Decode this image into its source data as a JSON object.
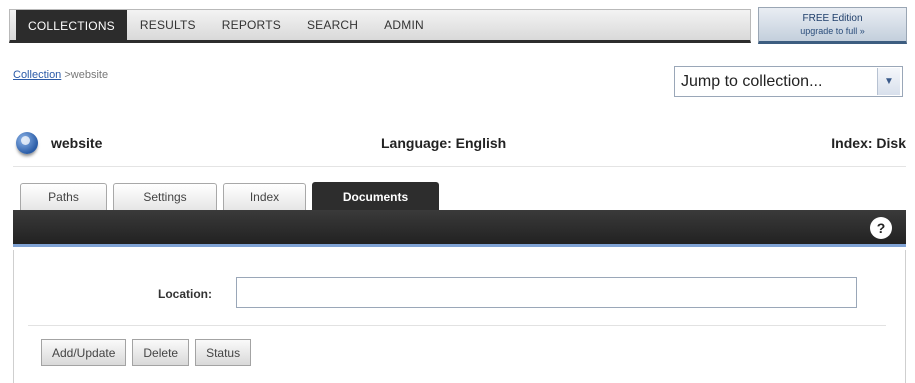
{
  "nav": {
    "items": [
      "COLLECTIONS",
      "RESULTS",
      "REPORTS",
      "SEARCH",
      "ADMIN"
    ],
    "active_index": 0
  },
  "edition": {
    "line1": "FREE Edition",
    "line2": "upgrade to full »"
  },
  "breadcrumb": {
    "link": "Collection",
    "sep": " >",
    "current": "website"
  },
  "jump": {
    "label": "Jump to collection...",
    "arrow_icon": "chevron-down-icon"
  },
  "collection": {
    "name": "website",
    "language": "Language: English",
    "index": "Index: Disk",
    "icon": "globe-icon"
  },
  "tabs": {
    "items": [
      "Paths",
      "Settings",
      "Index",
      "Documents"
    ],
    "active_index": 3
  },
  "panel": {
    "help_label": "?",
    "location_label": "Location:",
    "location_value": "",
    "buttons": {
      "add_update": "Add/Update",
      "delete": "Delete",
      "status": "Status"
    }
  },
  "colors": {
    "nav_dark": "#2c2c2c",
    "accent_blue": "#7fa2d4",
    "link": "#2a5aa8"
  }
}
